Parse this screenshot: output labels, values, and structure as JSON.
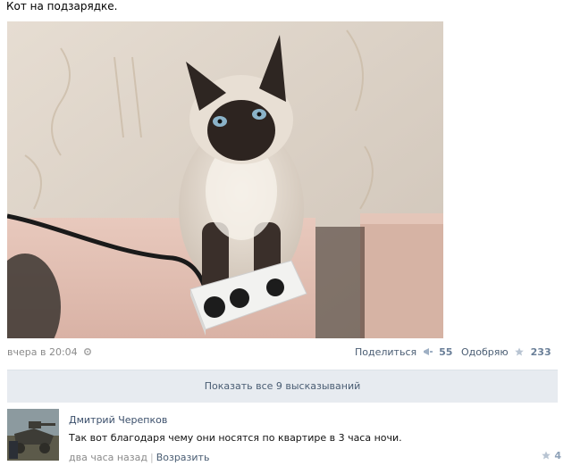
{
  "post": {
    "text": "Кот на подзарядке.",
    "date": "вчера в 20:04",
    "share_label": "Поделиться",
    "share_count": "55",
    "like_label": "Одобряю",
    "like_count": "233",
    "show_all_comments": "Показать все 9 высказываний"
  },
  "comment": {
    "author": "Дмитрий Черепков",
    "text": "Так вот благодаря чему они носятся по квартире в 3 часа ночи.",
    "time": "два часа назад",
    "reply_label": "Возразить",
    "like_count": "4"
  },
  "icons": {
    "date_settings": "gear-icon",
    "share": "megaphone-icon",
    "like": "star-icon",
    "comment_like": "star-icon"
  },
  "colors": {
    "link": "#4a5d73",
    "muted": "#8a8a8a",
    "bar_bg": "#e7ebf0"
  }
}
